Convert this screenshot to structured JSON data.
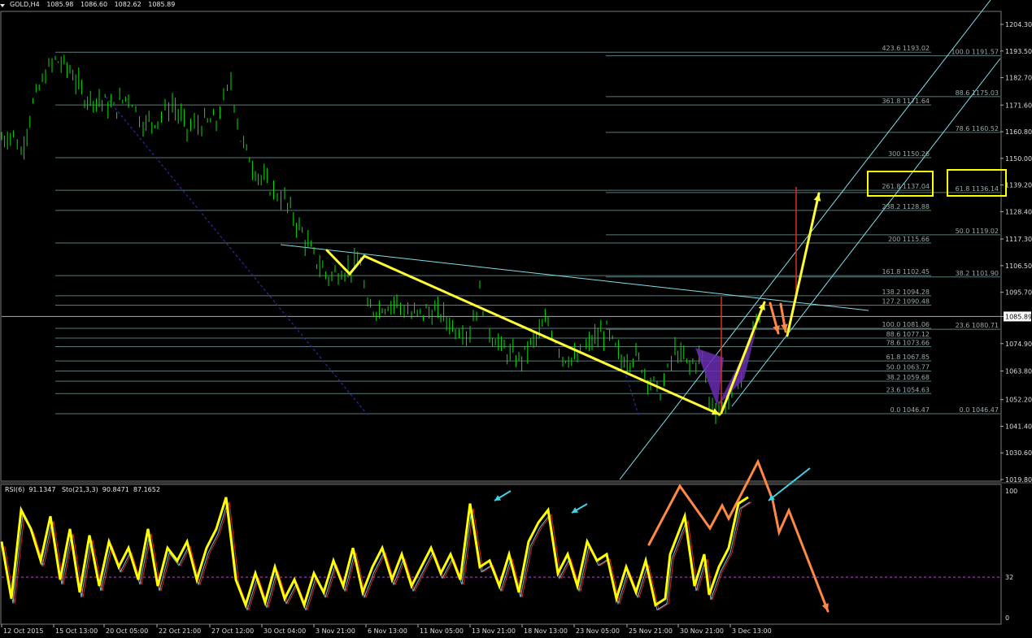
{
  "window": {
    "symbol": "GOLD,H4",
    "open": "1085.98",
    "high": "1086.60",
    "low": "1082.62",
    "close": "1085.89"
  },
  "chart_data": [
    {
      "type": "candlestick",
      "title": "GOLD,H4",
      "ylim": [
        1019.8,
        1204.3
      ],
      "price_ticks": [
        "1204.30",
        "1193.50",
        "1182.70",
        "1171.60",
        "1160.80",
        "1150.00",
        "1139.20",
        "1128.40",
        "1117.30",
        "1106.50",
        "1095.70",
        "1085.89",
        "1074.90",
        "1063.80",
        "1052.20",
        "1041.40",
        "1030.60",
        "1019.80"
      ],
      "current_price": 1085.89,
      "x_labels": [
        "12 Oct 2015",
        "15 Oct 13:00",
        "20 Oct 05:00",
        "22 Oct 21:00",
        "27 Oct 12:00",
        "30 Oct 04:00",
        "3 Nov 21:00",
        "6 Nov 13:00",
        "11 Nov 05:00",
        "13 Nov 21:00",
        "18 Nov 13:00",
        "23 Nov 05:00",
        "25 Nov 21:00",
        "30 Nov 21:00",
        "3 Dec 13:00"
      ],
      "price_path": [
        {
          "x": 0.0,
          "y": 1158
        },
        {
          "x": 0.012,
          "y": 1160
        },
        {
          "x": 0.02,
          "y": 1152
        },
        {
          "x": 0.032,
          "y": 1172
        },
        {
          "x": 0.045,
          "y": 1184
        },
        {
          "x": 0.055,
          "y": 1190
        },
        {
          "x": 0.07,
          "y": 1186
        },
        {
          "x": 0.085,
          "y": 1175
        },
        {
          "x": 0.1,
          "y": 1174
        },
        {
          "x": 0.115,
          "y": 1170
        },
        {
          "x": 0.13,
          "y": 1176
        },
        {
          "x": 0.145,
          "y": 1164
        },
        {
          "x": 0.16,
          "y": 1166
        },
        {
          "x": 0.175,
          "y": 1172
        },
        {
          "x": 0.19,
          "y": 1162
        },
        {
          "x": 0.205,
          "y": 1164
        },
        {
          "x": 0.22,
          "y": 1165
        },
        {
          "x": 0.235,
          "y": 1181
        },
        {
          "x": 0.245,
          "y": 1158
        },
        {
          "x": 0.26,
          "y": 1145
        },
        {
          "x": 0.275,
          "y": 1138
        },
        {
          "x": 0.29,
          "y": 1133
        },
        {
          "x": 0.305,
          "y": 1122
        },
        {
          "x": 0.32,
          "y": 1110
        },
        {
          "x": 0.335,
          "y": 1102
        },
        {
          "x": 0.345,
          "y": 1104
        },
        {
          "x": 0.355,
          "y": 1105
        },
        {
          "x": 0.368,
          "y": 1108
        },
        {
          "x": 0.375,
          "y": 1088
        },
        {
          "x": 0.39,
          "y": 1090
        },
        {
          "x": 0.405,
          "y": 1092
        },
        {
          "x": 0.42,
          "y": 1086
        },
        {
          "x": 0.435,
          "y": 1088
        },
        {
          "x": 0.45,
          "y": 1087
        },
        {
          "x": 0.465,
          "y": 1081
        },
        {
          "x": 0.48,
          "y": 1080
        },
        {
          "x": 0.49,
          "y": 1095
        },
        {
          "x": 0.5,
          "y": 1080
        },
        {
          "x": 0.515,
          "y": 1072
        },
        {
          "x": 0.53,
          "y": 1068
        },
        {
          "x": 0.545,
          "y": 1076
        },
        {
          "x": 0.56,
          "y": 1084
        },
        {
          "x": 0.575,
          "y": 1070
        },
        {
          "x": 0.59,
          "y": 1068
        },
        {
          "x": 0.605,
          "y": 1076
        },
        {
          "x": 0.62,
          "y": 1080
        },
        {
          "x": 0.635,
          "y": 1068
        },
        {
          "x": 0.65,
          "y": 1070
        },
        {
          "x": 0.665,
          "y": 1060
        },
        {
          "x": 0.675,
          "y": 1055
        },
        {
          "x": 0.69,
          "y": 1072
        },
        {
          "x": 0.705,
          "y": 1066
        },
        {
          "x": 0.718,
          "y": 1070
        },
        {
          "x": 0.725,
          "y": 1052
        },
        {
          "x": 0.735,
          "y": 1048
        },
        {
          "x": 0.745,
          "y": 1052
        },
        {
          "x": 0.758,
          "y": 1062
        },
        {
          "x": 0.77,
          "y": 1080
        },
        {
          "x": 0.78,
          "y": 1090
        }
      ],
      "horizontal_levels": [
        {
          "label": "423.6",
          "value": "1193.02"
        },
        {
          "label": "361.8",
          "value": "1171.64"
        },
        {
          "label": "300",
          "value": "1150.26"
        },
        {
          "label": "261.8",
          "value": "1137.04"
        },
        {
          "label": "238.2",
          "value": "1128.88"
        },
        {
          "label": "200",
          "value": "1115.66"
        },
        {
          "label": "161.8",
          "value": "1102.45"
        },
        {
          "label": "138.2",
          "value": "1094.28"
        },
        {
          "label": "127.2",
          "value": "1090.48"
        },
        {
          "label": "100.0",
          "value": "1081.06"
        },
        {
          "label": "88.6",
          "value": "1077.12"
        },
        {
          "label": "78.6",
          "value": "1073.66"
        },
        {
          "label": "61.8",
          "value": "1067.85"
        },
        {
          "label": "50.0",
          "value": "1063.77"
        },
        {
          "label": "38.2",
          "value": "1059.68"
        },
        {
          "label": "23.6",
          "value": "1054.63"
        },
        {
          "label": "0.0",
          "value": "1046.47"
        }
      ],
      "retrace_levels": [
        {
          "label": "100.0",
          "value": "1191.57"
        },
        {
          "label": "88.6",
          "value": "1175.03"
        },
        {
          "label": "78.6",
          "value": "1160.52"
        },
        {
          "label": "61.8",
          "value": "1136.14"
        },
        {
          "label": "50.0",
          "value": "1119.02"
        },
        {
          "label": "38.2",
          "value": "1101.90"
        },
        {
          "label": "23.6",
          "value": "1080.71"
        },
        {
          "label": "0.0",
          "value": "1046.47"
        }
      ],
      "colors": {
        "candles": "#00e000",
        "fib": "#5a7a7a",
        "yellow": "#ffff33",
        "orange": "#ff8844",
        "channel": "#7fdfe8",
        "purple": "#6a2bb0",
        "red_line": "#d83020",
        "highlight_box": "#ffff00",
        "rsi": "#ffff00",
        "sto_main": "#6ac0c8",
        "sto_signal": "#e02020",
        "blue_dotted": "#2a2aa8"
      }
    },
    {
      "type": "line",
      "title": "RSI(6) 91.1347  Sto(21,3,3) 90.8471 87.1652",
      "indicator": "RSI(6)",
      "rsi_value": "91.1347",
      "stoch": "Sto(21,3,3)",
      "stoch_main": "90.8471",
      "stoch_signal": "87.1652",
      "ylim": [
        0,
        100
      ],
      "levels": [
        "100",
        "32",
        "0"
      ],
      "rsi_path": [
        {
          "x": 0.0,
          "y": 60
        },
        {
          "x": 0.01,
          "y": 15
        },
        {
          "x": 0.02,
          "y": 85
        },
        {
          "x": 0.03,
          "y": 70
        },
        {
          "x": 0.04,
          "y": 45
        },
        {
          "x": 0.05,
          "y": 80
        },
        {
          "x": 0.06,
          "y": 30
        },
        {
          "x": 0.07,
          "y": 70
        },
        {
          "x": 0.08,
          "y": 20
        },
        {
          "x": 0.09,
          "y": 65
        },
        {
          "x": 0.1,
          "y": 25
        },
        {
          "x": 0.11,
          "y": 60
        },
        {
          "x": 0.12,
          "y": 40
        },
        {
          "x": 0.13,
          "y": 55
        },
        {
          "x": 0.14,
          "y": 30
        },
        {
          "x": 0.15,
          "y": 70
        },
        {
          "x": 0.16,
          "y": 25
        },
        {
          "x": 0.17,
          "y": 55
        },
        {
          "x": 0.18,
          "y": 45
        },
        {
          "x": 0.19,
          "y": 60
        },
        {
          "x": 0.2,
          "y": 30
        },
        {
          "x": 0.21,
          "y": 55
        },
        {
          "x": 0.22,
          "y": 70
        },
        {
          "x": 0.23,
          "y": 95
        },
        {
          "x": 0.24,
          "y": 30
        },
        {
          "x": 0.25,
          "y": 10
        },
        {
          "x": 0.26,
          "y": 35
        },
        {
          "x": 0.27,
          "y": 12
        },
        {
          "x": 0.28,
          "y": 40
        },
        {
          "x": 0.29,
          "y": 15
        },
        {
          "x": 0.3,
          "y": 30
        },
        {
          "x": 0.31,
          "y": 10
        },
        {
          "x": 0.32,
          "y": 35
        },
        {
          "x": 0.33,
          "y": 20
        },
        {
          "x": 0.34,
          "y": 45
        },
        {
          "x": 0.35,
          "y": 25
        },
        {
          "x": 0.36,
          "y": 55
        },
        {
          "x": 0.37,
          "y": 20
        },
        {
          "x": 0.38,
          "y": 40
        },
        {
          "x": 0.39,
          "y": 55
        },
        {
          "x": 0.4,
          "y": 30
        },
        {
          "x": 0.41,
          "y": 50
        },
        {
          "x": 0.42,
          "y": 25
        },
        {
          "x": 0.43,
          "y": 40
        },
        {
          "x": 0.44,
          "y": 55
        },
        {
          "x": 0.45,
          "y": 35
        },
        {
          "x": 0.46,
          "y": 50
        },
        {
          "x": 0.47,
          "y": 30
        },
        {
          "x": 0.48,
          "y": 90
        },
        {
          "x": 0.49,
          "y": 40
        },
        {
          "x": 0.5,
          "y": 45
        },
        {
          "x": 0.51,
          "y": 25
        },
        {
          "x": 0.52,
          "y": 50
        },
        {
          "x": 0.53,
          "y": 20
        },
        {
          "x": 0.54,
          "y": 60
        },
        {
          "x": 0.55,
          "y": 75
        },
        {
          "x": 0.56,
          "y": 85
        },
        {
          "x": 0.57,
          "y": 35
        },
        {
          "x": 0.58,
          "y": 50
        },
        {
          "x": 0.59,
          "y": 25
        },
        {
          "x": 0.6,
          "y": 60
        },
        {
          "x": 0.61,
          "y": 45
        },
        {
          "x": 0.62,
          "y": 50
        },
        {
          "x": 0.63,
          "y": 15
        },
        {
          "x": 0.64,
          "y": 40
        },
        {
          "x": 0.65,
          "y": 20
        },
        {
          "x": 0.66,
          "y": 45
        },
        {
          "x": 0.67,
          "y": 10
        },
        {
          "x": 0.68,
          "y": 15
        },
        {
          "x": 0.685,
          "y": 50
        },
        {
          "x": 0.69,
          "y": 60
        },
        {
          "x": 0.7,
          "y": 80
        },
        {
          "x": 0.71,
          "y": 25
        },
        {
          "x": 0.72,
          "y": 50
        },
        {
          "x": 0.725,
          "y": 18
        },
        {
          "x": 0.735,
          "y": 40
        },
        {
          "x": 0.745,
          "y": 55
        },
        {
          "x": 0.755,
          "y": 90
        },
        {
          "x": 0.765,
          "y": 95
        }
      ]
    }
  ],
  "annotations": {
    "level_boxes": [
      "261.8 1137.04",
      "61.8 1136.14"
    ]
  }
}
